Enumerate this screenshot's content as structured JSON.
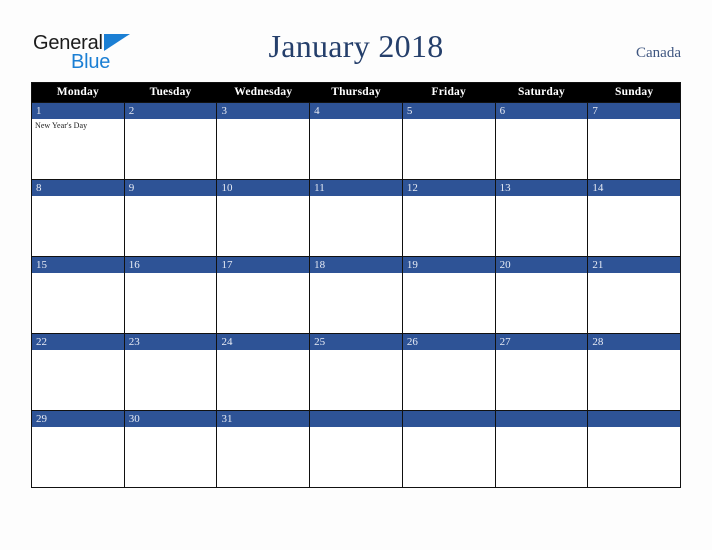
{
  "brand": {
    "name_part1": "General",
    "name_part2": "Blue",
    "triangle_icon": "triangle-icon",
    "accent_color": "#1b7fd4"
  },
  "header": {
    "title": "January 2018",
    "country": "Canada",
    "title_color": "#253f6b",
    "country_color": "#3f5680"
  },
  "calendar": {
    "month": "January",
    "year": "2018",
    "header_bg": "#000000",
    "date_bar_bg": "#2e5396",
    "border_color": "#111111",
    "weekdays": [
      "Monday",
      "Tuesday",
      "Wednesday",
      "Thursday",
      "Friday",
      "Saturday",
      "Sunday"
    ],
    "weeks": [
      [
        {
          "date": "1",
          "events": [
            "New Year's Day"
          ]
        },
        {
          "date": "2",
          "events": []
        },
        {
          "date": "3",
          "events": []
        },
        {
          "date": "4",
          "events": []
        },
        {
          "date": "5",
          "events": []
        },
        {
          "date": "6",
          "events": []
        },
        {
          "date": "7",
          "events": []
        }
      ],
      [
        {
          "date": "8",
          "events": []
        },
        {
          "date": "9",
          "events": []
        },
        {
          "date": "10",
          "events": []
        },
        {
          "date": "11",
          "events": []
        },
        {
          "date": "12",
          "events": []
        },
        {
          "date": "13",
          "events": []
        },
        {
          "date": "14",
          "events": []
        }
      ],
      [
        {
          "date": "15",
          "events": []
        },
        {
          "date": "16",
          "events": []
        },
        {
          "date": "17",
          "events": []
        },
        {
          "date": "18",
          "events": []
        },
        {
          "date": "19",
          "events": []
        },
        {
          "date": "20",
          "events": []
        },
        {
          "date": "21",
          "events": []
        }
      ],
      [
        {
          "date": "22",
          "events": []
        },
        {
          "date": "23",
          "events": []
        },
        {
          "date": "24",
          "events": []
        },
        {
          "date": "25",
          "events": []
        },
        {
          "date": "26",
          "events": []
        },
        {
          "date": "27",
          "events": []
        },
        {
          "date": "28",
          "events": []
        }
      ],
      [
        {
          "date": "29",
          "events": []
        },
        {
          "date": "30",
          "events": []
        },
        {
          "date": "31",
          "events": []
        },
        {
          "date": "",
          "events": []
        },
        {
          "date": "",
          "events": []
        },
        {
          "date": "",
          "events": []
        },
        {
          "date": "",
          "events": []
        }
      ]
    ]
  }
}
